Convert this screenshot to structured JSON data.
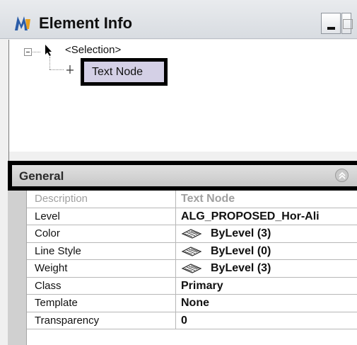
{
  "window": {
    "title": "Element Info",
    "minimize_icon": "minimize-icon",
    "maximize_icon": "maximize-icon",
    "close_icon": "close-icon",
    "title_bar_color": "#dde0e5"
  },
  "tree": {
    "root_label": "<Selection>",
    "child_label": "Text Node",
    "selected_color": "#d4d0e6"
  },
  "general": {
    "header_label": "General",
    "collapse_icon": "collapse-chevron-icon"
  },
  "properties": [
    {
      "name": "Description",
      "value": "Text Node",
      "disabled": true,
      "icon": null
    },
    {
      "name": "Level",
      "value": "ALG_PROPOSED_Hor-Ali",
      "disabled": false,
      "icon": null
    },
    {
      "name": "Color",
      "value": "ByLevel (3)",
      "disabled": false,
      "icon": "bylevel-swatch-icon"
    },
    {
      "name": "Line Style",
      "value": "ByLevel (0)",
      "disabled": false,
      "icon": "bylevel-swatch-icon"
    },
    {
      "name": "Weight",
      "value": "ByLevel (3)",
      "disabled": false,
      "icon": "bylevel-swatch-icon"
    },
    {
      "name": "Class",
      "value": "Primary",
      "disabled": false,
      "icon": null
    },
    {
      "name": "Template",
      "value": "None",
      "disabled": false,
      "icon": null
    },
    {
      "name": "Transparency",
      "value": "0",
      "disabled": false,
      "icon": null
    }
  ]
}
